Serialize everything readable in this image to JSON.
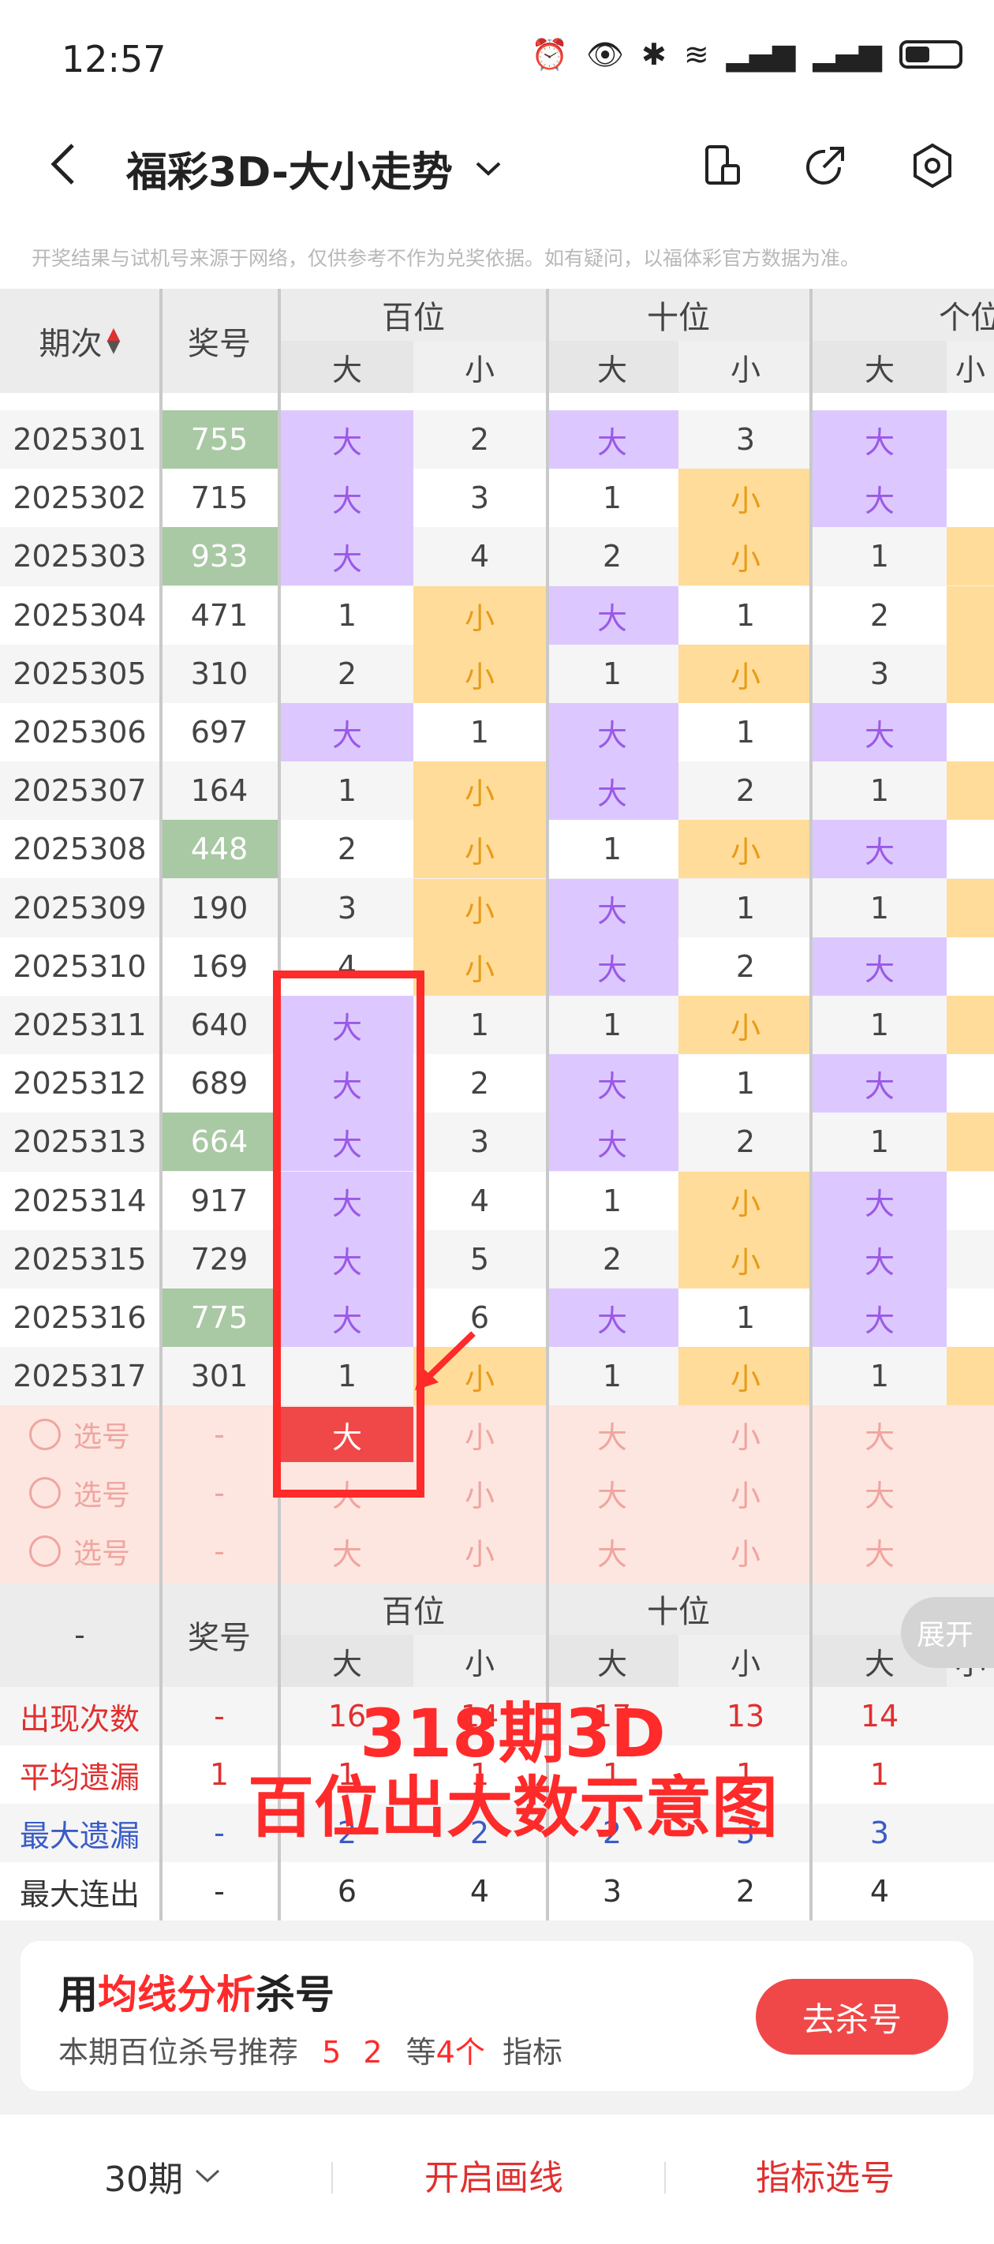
{
  "status": {
    "time": "12:57"
  },
  "nav": {
    "title": "福彩3D-大小走势",
    "dropdown_icon": "chevron-down-icon"
  },
  "notice": "开奖结果与试机号来源于网络，仅供参考不作为兑奖依据。如有疑问，以福体彩官方数据为准。",
  "table": {
    "col_period": "期次",
    "col_number": "奖号",
    "group_hundreds": "百位",
    "group_tens": "十位",
    "group_units": "个位",
    "big": "大",
    "small": "小",
    "rows": [
      {
        "period": "2025301",
        "number": "755",
        "cells": [
          "大",
          "2",
          "大",
          "3",
          "大"
        ]
      },
      {
        "period": "2025302",
        "number": "715",
        "cells": [
          "大",
          "3",
          "1",
          "小",
          "大"
        ]
      },
      {
        "period": "2025303",
        "number": "933",
        "cells": [
          "大",
          "4",
          "2",
          "小",
          "1"
        ]
      },
      {
        "period": "2025304",
        "number": "471",
        "cells": [
          "1",
          "小",
          "大",
          "1",
          "2"
        ]
      },
      {
        "period": "2025305",
        "number": "310",
        "cells": [
          "2",
          "小",
          "1",
          "小",
          "3"
        ]
      },
      {
        "period": "2025306",
        "number": "697",
        "cells": [
          "大",
          "1",
          "大",
          "1",
          "大"
        ]
      },
      {
        "period": "2025307",
        "number": "164",
        "cells": [
          "1",
          "小",
          "大",
          "2",
          "1"
        ]
      },
      {
        "period": "2025308",
        "number": "448",
        "cells": [
          "2",
          "小",
          "1",
          "小",
          "大"
        ]
      },
      {
        "period": "2025309",
        "number": "190",
        "cells": [
          "3",
          "小",
          "大",
          "1",
          "1"
        ]
      },
      {
        "period": "2025310",
        "number": "169",
        "cells": [
          "4",
          "小",
          "大",
          "2",
          "大"
        ]
      },
      {
        "period": "2025311",
        "number": "640",
        "cells": [
          "大",
          "1",
          "1",
          "小",
          "1"
        ]
      },
      {
        "period": "2025312",
        "number": "689",
        "cells": [
          "大",
          "2",
          "大",
          "1",
          "大"
        ]
      },
      {
        "period": "2025313",
        "number": "664",
        "cells": [
          "大",
          "3",
          "大",
          "2",
          "1"
        ]
      },
      {
        "period": "2025314",
        "number": "917",
        "cells": [
          "大",
          "4",
          "1",
          "小",
          "大"
        ]
      },
      {
        "period": "2025315",
        "number": "729",
        "cells": [
          "大",
          "5",
          "2",
          "小",
          "大"
        ]
      },
      {
        "period": "2025316",
        "number": "775",
        "cells": [
          "大",
          "6",
          "大",
          "1",
          "大"
        ]
      },
      {
        "period": "2025317",
        "number": "301",
        "cells": [
          "1",
          "小",
          "1",
          "小",
          "1"
        ]
      }
    ],
    "select_label": "选号",
    "select_dash": "-",
    "select_rows": [
      {
        "cells": [
          "大",
          "小",
          "大",
          "小",
          "大"
        ]
      },
      {
        "cells": [
          "大",
          "小",
          "大",
          "小",
          "大"
        ]
      },
      {
        "cells": [
          "大",
          "小",
          "大",
          "小",
          "大"
        ]
      }
    ]
  },
  "stats": {
    "dash": "-",
    "col_number": "奖号",
    "group_hundreds": "百位",
    "group_tens": "十位",
    "expand": "展开",
    "rows": [
      {
        "label": "出现次数",
        "color": "#e03030",
        "num": "-",
        "values": [
          "16",
          "14",
          "17",
          "13",
          "14"
        ]
      },
      {
        "label": "平均遗漏",
        "color": "#e03030",
        "num": "1",
        "values": [
          "1",
          "1",
          "1",
          "1",
          "1"
        ]
      },
      {
        "label": "最大遗漏",
        "color": "#3a5bc7",
        "num": "-",
        "values": [
          "2",
          "2",
          "2",
          "3",
          "3"
        ]
      },
      {
        "label": "最大连出",
        "color": "#333333",
        "num": "-",
        "values": [
          "6",
          "4",
          "3",
          "2",
          "4"
        ]
      }
    ]
  },
  "annotation": {
    "line1": "318期3D",
    "line2": "百位出大数示意图"
  },
  "promo": {
    "title_pre": "用",
    "title_highlight": "均线分析",
    "title_post": "杀号",
    "sub_pre": "本期百位杀号推荐",
    "sub_nums": "5 2",
    "sub_mid": "等",
    "sub_count": "4个",
    "sub_post": "指标",
    "button": "去杀号"
  },
  "footer": {
    "period_select": "30期",
    "draw_line": "开启画线",
    "indicator_select": "指标选号"
  },
  "colors": {
    "purple": "#dcc8ff",
    "orange": "#ffdc9a",
    "green": "#a9c8a4",
    "select_bg": "#fde6e0",
    "accent_red": "#ff2a2a"
  }
}
